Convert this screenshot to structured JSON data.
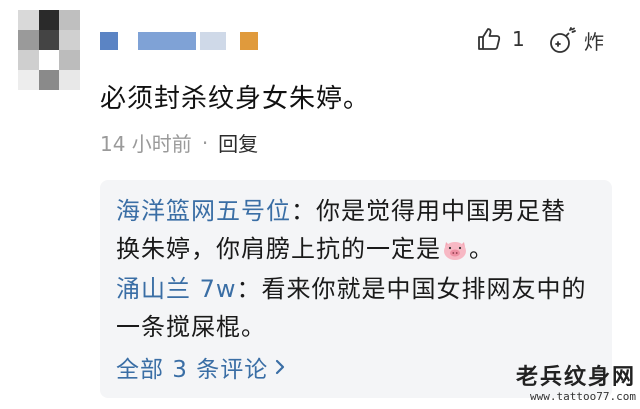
{
  "comment": {
    "avatar_colors": [
      "#d9d9d9",
      "#2a2a2a",
      "#bfbfbf",
      "#9a9a9a",
      "#444444",
      "#d0d0d0",
      "#cfcfcf",
      "#ffffff",
      "#bcbcbc",
      "#ededed",
      "#8a8a8a",
      "#e8e8e8"
    ],
    "name_blocks": [
      "#5b84c4",
      "#7fa2d6",
      "#cfd9e8",
      "#e09a3c"
    ],
    "like_count": "1",
    "bomb_label": "炸",
    "text": "必须封杀纹身女朱婷。",
    "time": "14 小时前",
    "separator": "·",
    "reply_label": "回复"
  },
  "replies": [
    {
      "author": "海洋篮网五号位",
      "colon": "：",
      "line1": "你是觉得用中国男足替",
      "line2a": "换朱婷，你肩膀上抗的一定是",
      "line2b": "。"
    },
    {
      "author": "涌山兰 7w",
      "colon": "：",
      "line1": "看来你就是中国女排网友中的",
      "line2a": "一条搅屎棍。",
      "line2b": ""
    }
  ],
  "more_replies": "全部 3 条评论",
  "watermark": {
    "line1": "老兵纹身网",
    "line2": "www.tattoo77.com"
  },
  "colors": {
    "link": "#3a6ea5",
    "meta": "#9a9a9a",
    "reply_bg": "#f4f5f7"
  }
}
